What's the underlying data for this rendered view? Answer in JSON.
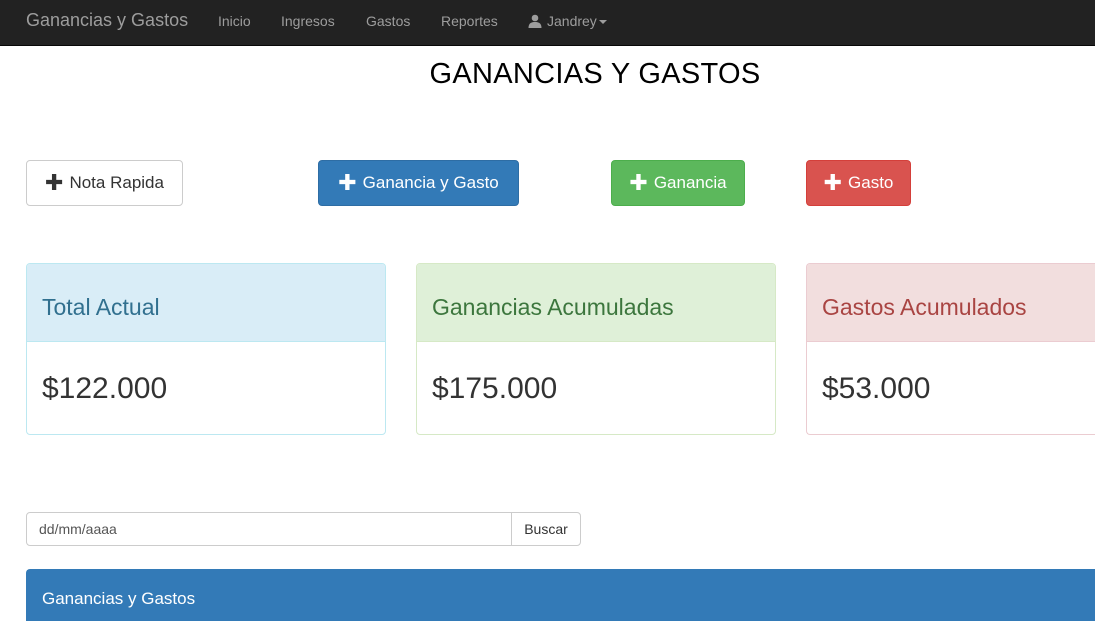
{
  "navbar": {
    "brand": "Ganancias y Gastos",
    "links": [
      "Inicio",
      "Ingresos",
      "Gastos",
      "Reportes"
    ],
    "user": "Jandrey",
    "user_icon": "user-icon",
    "bg_color": "#222222"
  },
  "page": {
    "title": "GANANCIAS Y GASTOS"
  },
  "actions": {
    "nota_rapida": "Nota Rapida",
    "ganancia_y_gasto": "Ganancia y Gasto",
    "ganancia": "Ganancia",
    "gasto": "Gasto",
    "plus_glyph": "✚"
  },
  "summary": {
    "total": {
      "label": "Total Actual",
      "value": "$122.000",
      "color": "#31708f"
    },
    "ganancias": {
      "label": "Ganancias Acumuladas",
      "value": "$175.000",
      "color": "#3c763d"
    },
    "gastos": {
      "label": "Gastos Acumulados",
      "value": "$53.000",
      "color": "#a94442"
    }
  },
  "search": {
    "placeholder": "dd/mm/aaaa",
    "button": "Buscar"
  },
  "table_panel": {
    "title": "Ganancias y Gastos",
    "color": "#337ab7"
  }
}
